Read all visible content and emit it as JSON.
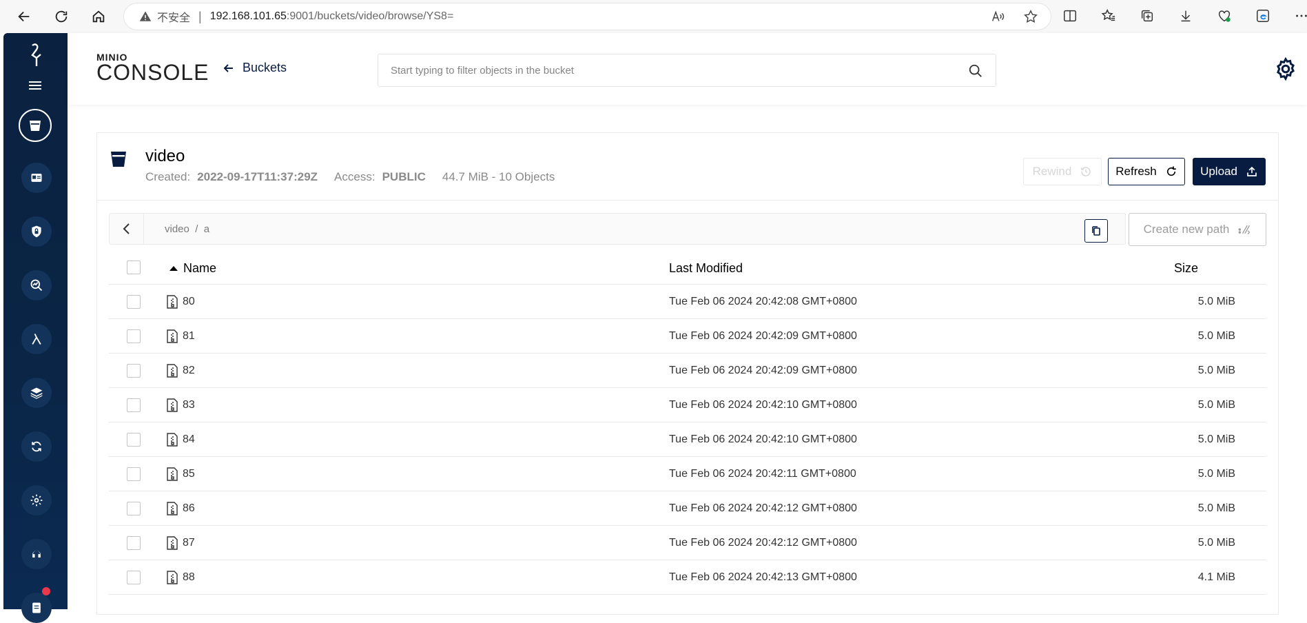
{
  "browser": {
    "insecure_label": "不安全",
    "url_host": "192.168.101.65",
    "url_rest": ":9001/buckets/video/browse/YS8="
  },
  "header": {
    "brand_top": "MINIO",
    "brand_bottom": "CONSOLE",
    "back_label": "Buckets",
    "search_placeholder": "Start typing to filter objects in the bucket"
  },
  "bucket": {
    "name": "video",
    "created_label": "Created:",
    "created_value": "2022-09-17T11:37:29Z",
    "access_label": "Access:",
    "access_value": "PUBLIC",
    "stats": "44.7 MiB - 10 Objects",
    "rewind_label": "Rewind",
    "refresh_label": "Refresh",
    "upload_label": "Upload"
  },
  "path": {
    "text": "video  /  a",
    "create_new_path_label": "Create new path"
  },
  "table": {
    "columns": {
      "name": "Name",
      "modified": "Last Modified",
      "size": "Size"
    },
    "rows": [
      {
        "name": "80",
        "modified": "Tue Feb 06 2024 20:42:08 GMT+0800",
        "size": "5.0 MiB"
      },
      {
        "name": "81",
        "modified": "Tue Feb 06 2024 20:42:09 GMT+0800",
        "size": "5.0 MiB"
      },
      {
        "name": "82",
        "modified": "Tue Feb 06 2024 20:42:09 GMT+0800",
        "size": "5.0 MiB"
      },
      {
        "name": "83",
        "modified": "Tue Feb 06 2024 20:42:10 GMT+0800",
        "size": "5.0 MiB"
      },
      {
        "name": "84",
        "modified": "Tue Feb 06 2024 20:42:10 GMT+0800",
        "size": "5.0 MiB"
      },
      {
        "name": "85",
        "modified": "Tue Feb 06 2024 20:42:11 GMT+0800",
        "size": "5.0 MiB"
      },
      {
        "name": "86",
        "modified": "Tue Feb 06 2024 20:42:12 GMT+0800",
        "size": "5.0 MiB"
      },
      {
        "name": "87",
        "modified": "Tue Feb 06 2024 20:42:12 GMT+0800",
        "size": "5.0 MiB"
      },
      {
        "name": "88",
        "modified": "Tue Feb 06 2024 20:42:13 GMT+0800",
        "size": "4.1 MiB"
      }
    ]
  },
  "colors": {
    "sidebar": "#0b2140",
    "primary": "#081c42",
    "badge": "#e9394b"
  }
}
